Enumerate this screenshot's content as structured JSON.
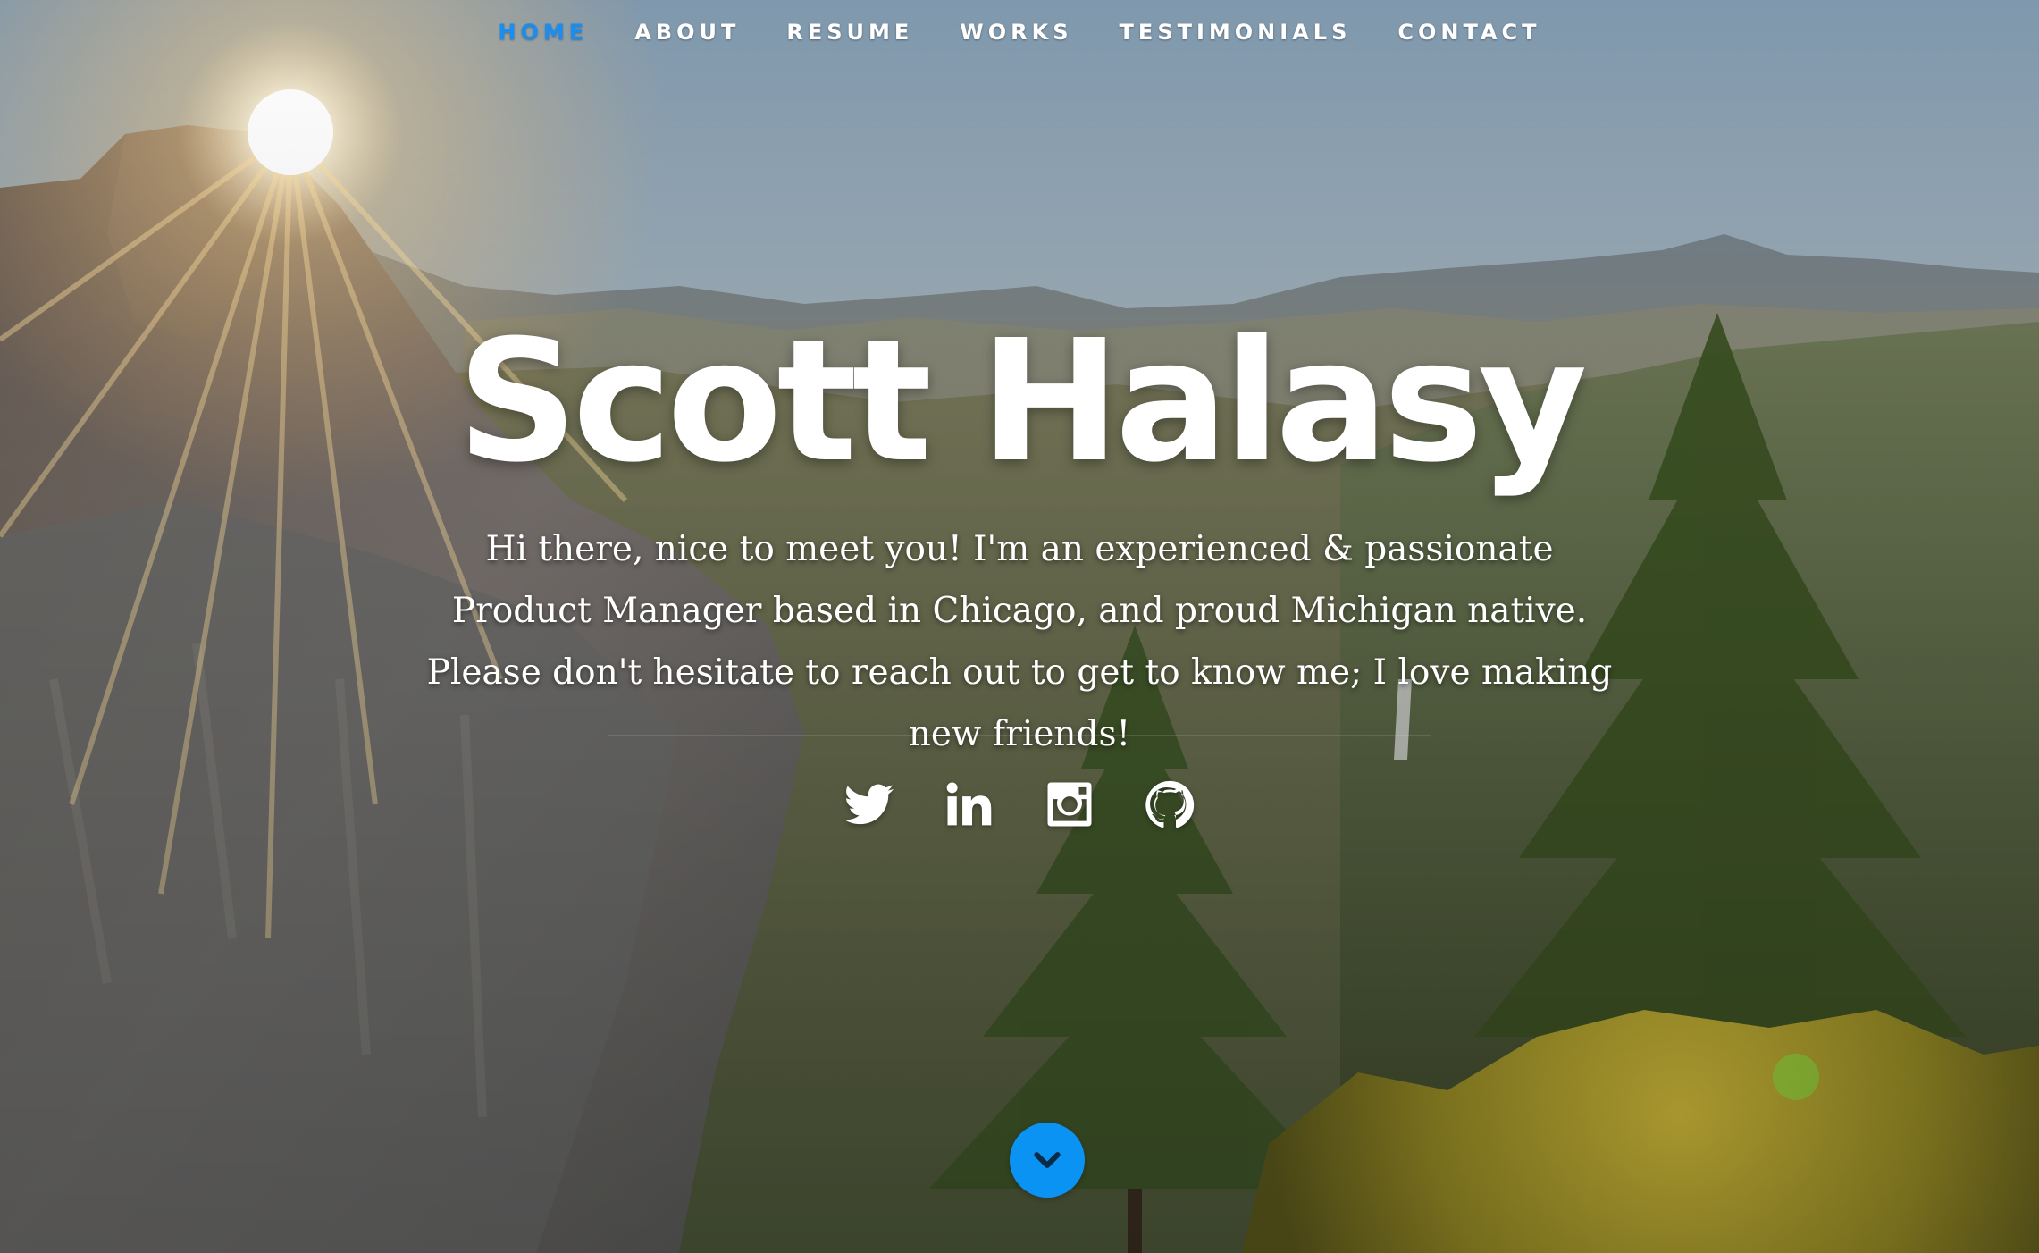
{
  "nav": {
    "items": [
      {
        "label": "HOME",
        "active": true
      },
      {
        "label": "ABOUT",
        "active": false
      },
      {
        "label": "RESUME",
        "active": false
      },
      {
        "label": "WORKS",
        "active": false
      },
      {
        "label": "TESTIMONIALS",
        "active": false
      },
      {
        "label": "CONTACT",
        "active": false
      }
    ],
    "active_color": "#1a8ef0",
    "text_color": "#ffffff"
  },
  "hero": {
    "name": "Scott Halasy",
    "intro": "Hi there, nice to meet you! I'm an experienced & passionate Product Manager based in Chicago, and proud Michigan native. Please don't hesitate to reach out to get to know me; I love making new friends!",
    "background": "mountain-valley-sunrise-photo"
  },
  "social": {
    "icons": [
      "twitter-icon",
      "linkedin-icon",
      "instagram-icon",
      "github-icon"
    ]
  },
  "scroll_button": {
    "icon": "chevron-down-icon",
    "color": "#0a93f2"
  }
}
